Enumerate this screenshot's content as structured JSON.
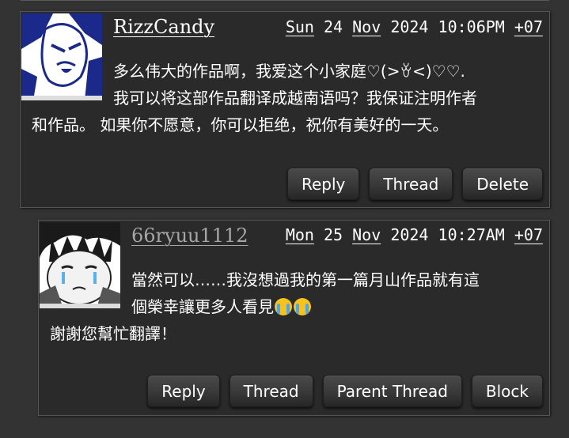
{
  "comments": [
    {
      "username": "RizzCandy",
      "date": {
        "day_name": "Sun",
        "day": "24",
        "month": "Nov",
        "year": "2024",
        "time": "10:06PM",
        "tz": "+07"
      },
      "lines": [
        "多么伟大的作品啊，我爱这个小家庭♡(>ꈊ<)♡♡.",
        "我可以将这部作品翻译成越南语吗？我保证注明作者",
        "和作品。 如果你不愿意，你可以拒绝，祝你有美好的一天。"
      ],
      "buttons": [
        "Reply",
        "Thread",
        "Delete"
      ]
    },
    {
      "username": "66ryuu1112",
      "date": {
        "day_name": "Mon",
        "day": "25",
        "month": "Nov",
        "year": "2024",
        "time": "10:27AM",
        "tz": "+07"
      },
      "lines": [
        "當然可以……我沒想過我的第一篇月山作品就有這",
        "個榮幸讓更多人看見",
        "謝謝您幫忙翻譯！"
      ],
      "emoji": "loudly-crying-face",
      "buttons": [
        "Reply",
        "Thread",
        "Parent Thread",
        "Block"
      ]
    }
  ]
}
